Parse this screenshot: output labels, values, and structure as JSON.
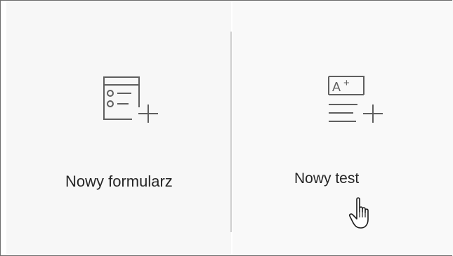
{
  "options": [
    {
      "label": "Nowy formularz",
      "icon": "new-form-icon"
    },
    {
      "label": "Nowy test",
      "icon": "new-quiz-icon"
    }
  ],
  "colors": {
    "icon_stroke": "#5f5f5f",
    "divider": "#cfcfcf",
    "card_background": "#f7f7f7"
  },
  "cursor": "hand-pointer-cursor-icon"
}
